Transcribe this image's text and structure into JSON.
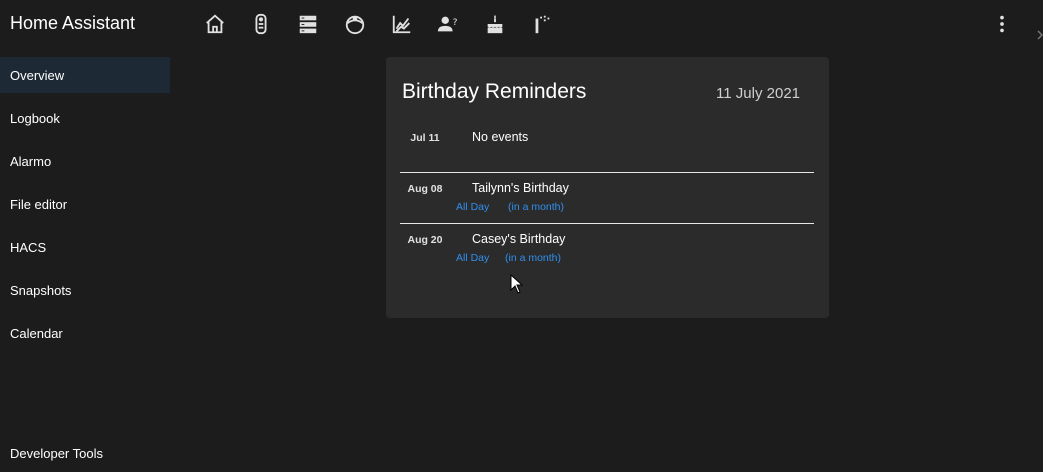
{
  "app": {
    "title": "Home Assistant"
  },
  "toolbar": {
    "icons": [
      "home-icon",
      "remote-icon",
      "server-icon",
      "robot-vacuum-icon",
      "chart-icon",
      "person-question-icon",
      "birthday-cake-icon",
      "tap-icon"
    ],
    "menu_icon": "dots-vertical-icon"
  },
  "sidebar": {
    "items": [
      {
        "label": "Overview",
        "active": true
      },
      {
        "label": "Logbook"
      },
      {
        "label": "Alarmo"
      },
      {
        "label": "File editor"
      },
      {
        "label": "HACS"
      },
      {
        "label": "Snapshots"
      },
      {
        "label": "Calendar"
      }
    ],
    "footer": {
      "label": "Developer Tools"
    }
  },
  "card": {
    "title": "Birthday Reminders",
    "date": "11 July 2021",
    "events": [
      {
        "date": "Jul 11",
        "title": "No events"
      },
      {
        "date": "Aug 08",
        "title": "Tailynn's Birthday",
        "time": "All Day",
        "relative": "(in a month)"
      },
      {
        "date": "Aug 20",
        "title": "Casey's Birthday",
        "time": "All Day",
        "relative": "(in a month)"
      }
    ]
  },
  "colors": {
    "background": "#1c1c1c",
    "card": "#2b2b2b",
    "accent": "#2f8ff0",
    "active_item": "#1d2a35"
  }
}
